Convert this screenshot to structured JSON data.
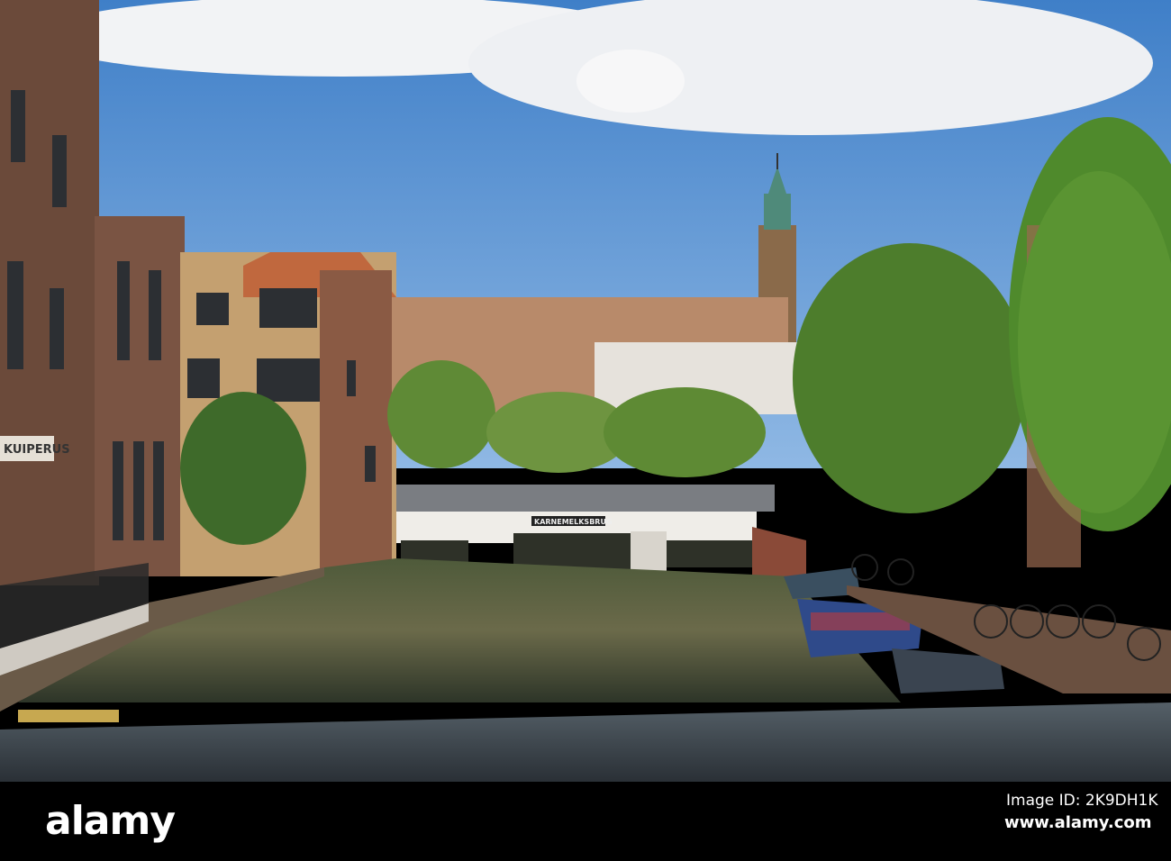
{
  "photo": {
    "bridge_sign": "KARNEMELKSBRUG",
    "shop_sign": "KUIPERUS"
  },
  "watermark": {
    "logo": "alamy",
    "image_id": "Image ID: 2K9DH1K",
    "website": "www.alamy.com"
  }
}
